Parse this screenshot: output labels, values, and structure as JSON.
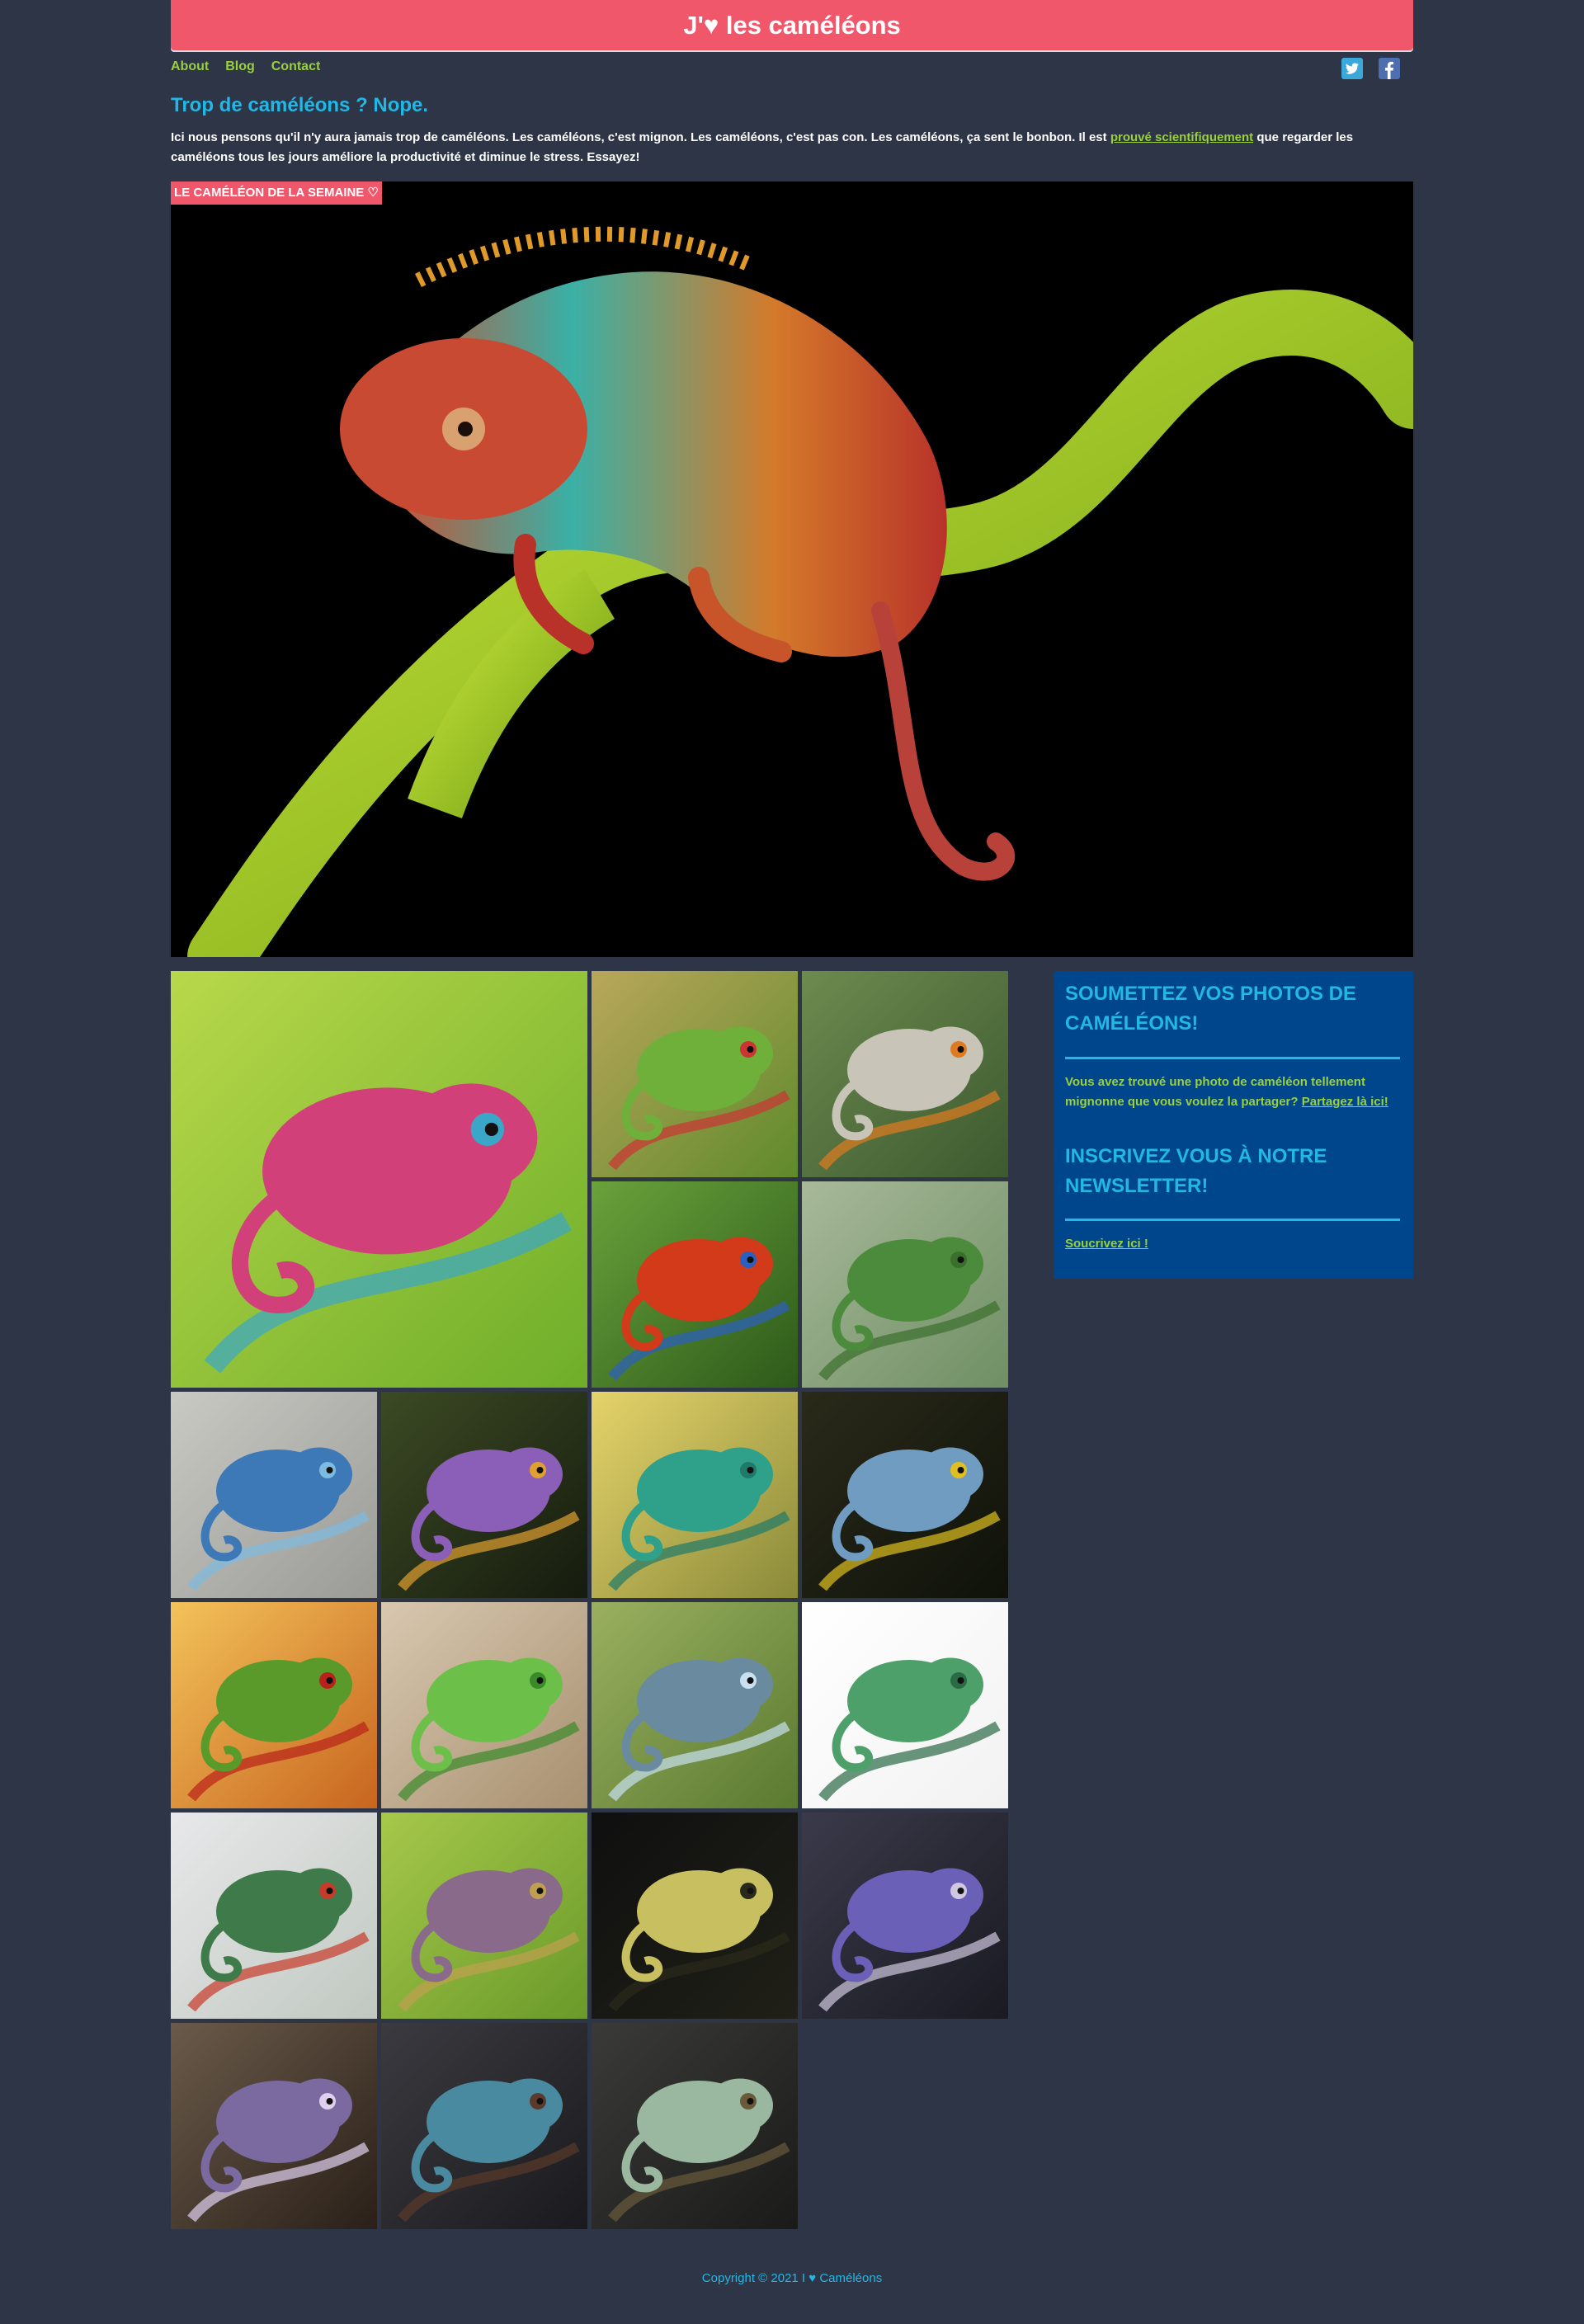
{
  "site": {
    "title": "J'♥ les caméléons"
  },
  "nav": {
    "items": [
      {
        "label": "About"
      },
      {
        "label": "Blog"
      },
      {
        "label": "Contact"
      }
    ]
  },
  "social": {
    "twitter": "twitter-icon",
    "facebook": "facebook-icon"
  },
  "main": {
    "title": "Trop de caméléons ? Nope.",
    "intro_before": "Ici nous pensons qu'il n'y aura jamais trop de caméléons. Les caméléons, c'est mignon. Les caméléons, c'est pas con. Les caméléons, ça sent le bonbon. Il est ",
    "intro_link": "prouvé scientifiquement",
    "intro_after": " que regarder les caméléons tous les jours améliore la productivité et diminue le stress. Essayez!"
  },
  "hero": {
    "badge": "LE CAMÉLÉON DE LA SEMAINE ♡"
  },
  "gallery": {
    "tiles": [
      {
        "bg": [
          "#b8d84a",
          "#6fae2a"
        ],
        "body": "#d2407a",
        "accent": "#3aa7c8"
      },
      {
        "bg": [
          "#b9a75a",
          "#5f8a2c"
        ],
        "body": "#6fb03a",
        "accent": "#c33"
      },
      {
        "bg": [
          "#6d8a4f",
          "#3c5a2f"
        ],
        "body": "#c8c4b8",
        "accent": "#e07a1f"
      },
      {
        "bg": [
          "#6aa23b",
          "#2d5a1a"
        ],
        "body": "#d23a1a",
        "accent": "#2b5fc0"
      },
      {
        "bg": [
          "#a8b99a",
          "#6f8f64"
        ],
        "body": "#4c8b3c",
        "accent": "#3a6f2c"
      },
      {
        "bg": [
          "#c9c9c4",
          "#9a9a96"
        ],
        "body": "#3d79b6",
        "accent": "#7dbbe0"
      },
      {
        "bg": [
          "#3c4a24",
          "#151b0e"
        ],
        "body": "#8b5fb8",
        "accent": "#e0a030"
      },
      {
        "bg": [
          "#e5d36a",
          "#8a8a3a"
        ],
        "body": "#2fa08a",
        "accent": "#1f7a6a"
      },
      {
        "bg": [
          "#2a2a1a",
          "#0f120a"
        ],
        "body": "#6f9cc0",
        "accent": "#e0c020"
      },
      {
        "bg": [
          "#f3c25a",
          "#c8651f"
        ],
        "body": "#5a9a2a",
        "accent": "#b8221a"
      },
      {
        "bg": [
          "#d8c8b0",
          "#a89070"
        ],
        "body": "#6cc04a",
        "accent": "#3a8a2a"
      },
      {
        "bg": [
          "#9ab060",
          "#5a7a30"
        ],
        "body": "#6a8aa0",
        "accent": "#c8e0f0"
      },
      {
        "bg": [
          "#ffffff",
          "#f2f2f2"
        ],
        "body": "#4ea06a",
        "accent": "#2a6a44"
      },
      {
        "bg": [
          "#e8e8ea",
          "#c0c8c0"
        ],
        "body": "#3e7a4a",
        "accent": "#c83a2a"
      },
      {
        "bg": [
          "#a6c84a",
          "#6a9a2a"
        ],
        "body": "#8a6a8a",
        "accent": "#c0a050"
      },
      {
        "bg": [
          "#0f0f0f",
          "#202018"
        ],
        "body": "#c8c060",
        "accent": "#2a2a1a"
      },
      {
        "bg": [
          "#3a3a4a",
          "#1a1a22"
        ],
        "body": "#6a60b8",
        "accent": "#d0c8e0"
      },
      {
        "bg": [
          "#6a5a4a",
          "#2a2018"
        ],
        "body": "#7a6aa0",
        "accent": "#e0d0f0"
      },
      {
        "bg": [
          "#3a3a40",
          "#1a1a1e"
        ],
        "body": "#4a8aa0",
        "accent": "#5a3a2a"
      },
      {
        "bg": [
          "#3a3a38",
          "#1a1a18"
        ],
        "body": "#9ab8a0",
        "accent": "#6a5a3a"
      }
    ]
  },
  "sidebar": {
    "submit_title": "SOUMETTEZ VOS PHOTOS DE CAMÉLÉONS!",
    "submit_text": "Vous avez trouvé une photo de caméléon tellement mignonne que vous voulez la partager? ",
    "submit_link": "Partagez là ici!",
    "newsletter_title": "INSCRIVEZ VOUS À NOTRE NEWSLETTER!",
    "newsletter_link": "Soucrivez ici !"
  },
  "footer": {
    "text": "Copyright © 2021 I ♥ Caméléons"
  }
}
